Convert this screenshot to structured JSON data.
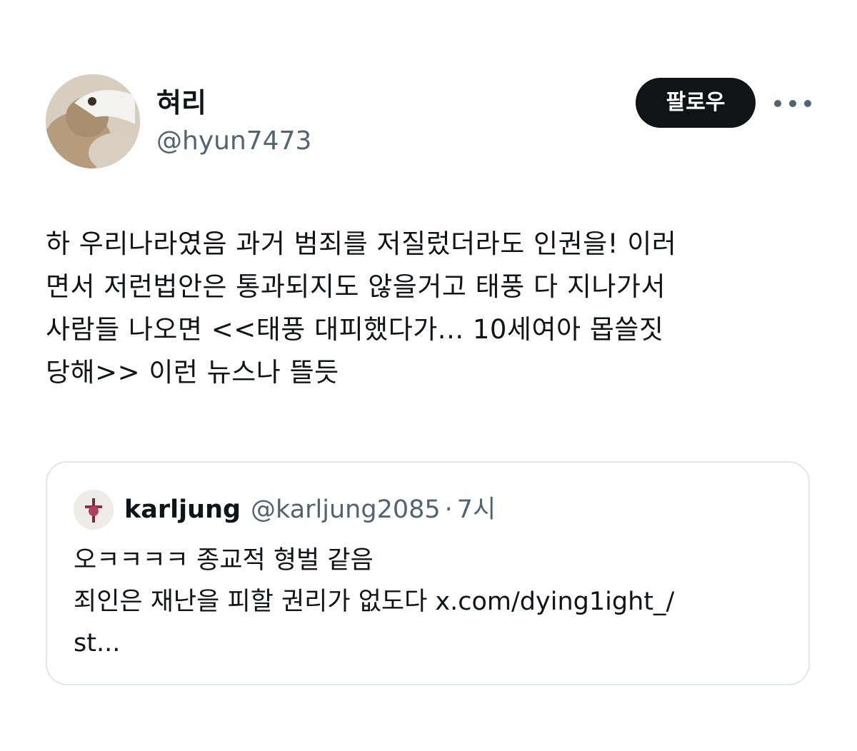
{
  "author": {
    "name": "혀리",
    "handle": "@hyun7473"
  },
  "actions": {
    "follow_label": "팔로우"
  },
  "tweet": {
    "text": "하 우리나라였음 과거 범죄를 저질렀더라도 인권을! 이러\n면서 저런법안은 통과되지도 않을거고 태풍 다 지나가서\n사람들 나오면 <<태풍 대피했다가... 10세여아 몹쓸짓\n당해>> 이런 뉴스나 뜰듯"
  },
  "quote": {
    "name": "karljung",
    "handle": "@karljung2085",
    "separator": "·",
    "time": "7시",
    "text": "오ㅋㅋㅋㅋ 종교적 형벌 같음\n죄인은 재난을 피할 권리가 없도다 x.com/dying1ight_/\nst..."
  },
  "colors": {
    "text": "#0f1419",
    "secondary": "#536471",
    "follow_bg": "#0f1419",
    "follow_text": "#ffffff",
    "card_border": "#e1e6ea"
  },
  "icons": {
    "more": "more-horizontal-icon"
  }
}
